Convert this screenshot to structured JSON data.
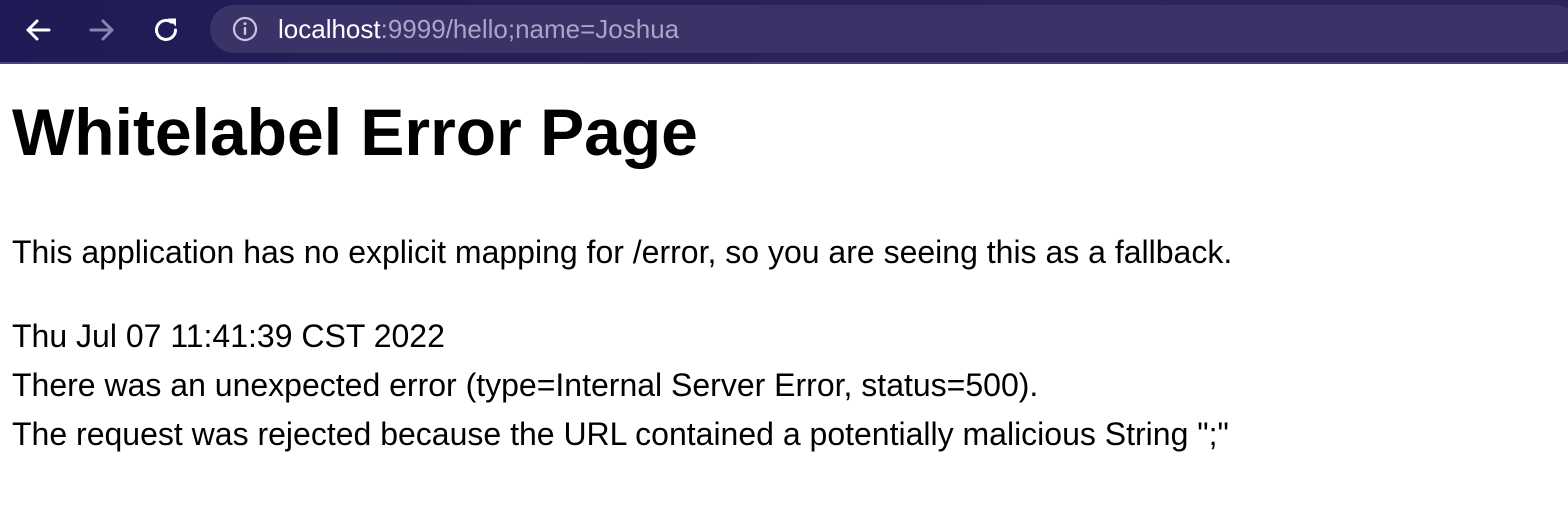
{
  "browser": {
    "url_host": "localhost",
    "url_rest": ":9999/hello;name=Joshua",
    "icons": {
      "back": "arrow-left-icon",
      "forward": "arrow-right-icon",
      "reload": "reload-icon",
      "info": "info-icon"
    },
    "colors": {
      "toolbar": "#241e56",
      "omnibox": "#3a3368",
      "url_host": "#ffffff",
      "url_rest": "#a9a4c9"
    }
  },
  "page": {
    "title": "Whitelabel Error Page",
    "description": "This application has no explicit mapping for /error, so you are seeing this as a fallback.",
    "timestamp": "Thu Jul 07 11:41:39 CST 2022",
    "error_line": "There was an unexpected error (type=Internal Server Error, status=500).",
    "reason_line": "The request was rejected because the URL contained a potentially malicious String \";\""
  }
}
